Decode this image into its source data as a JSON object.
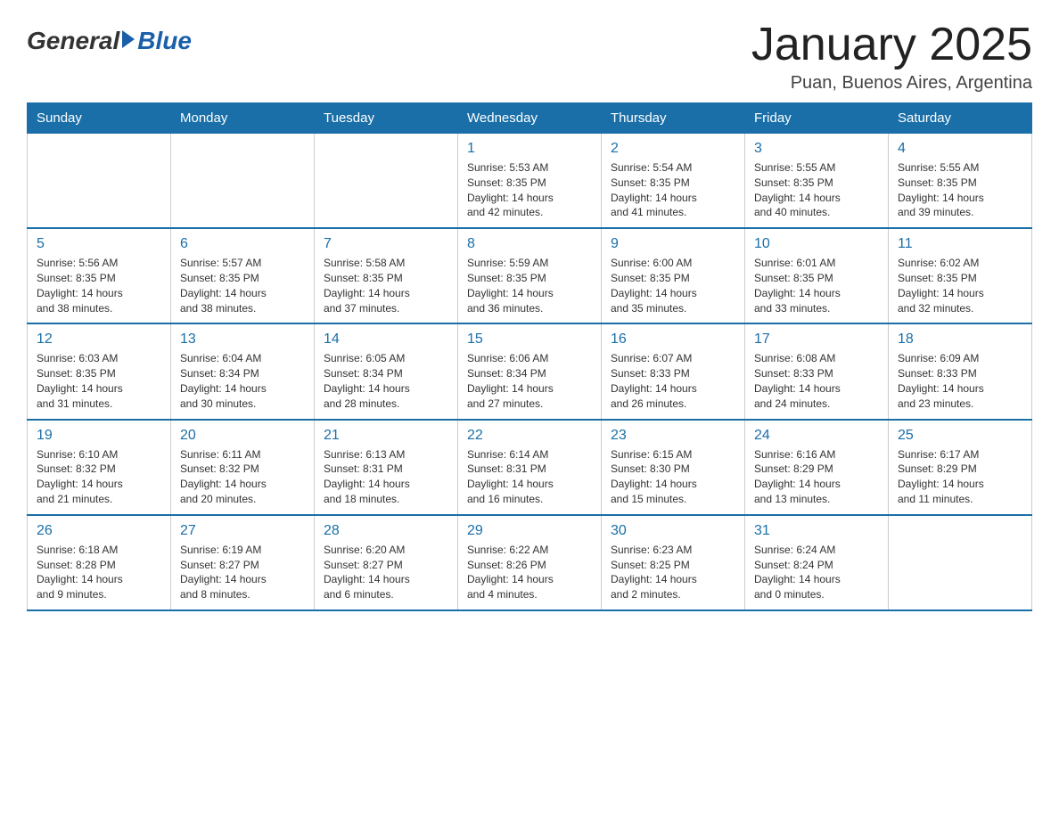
{
  "header": {
    "logo": {
      "general": "General",
      "blue": "Blue"
    },
    "title": "January 2025",
    "location": "Puan, Buenos Aires, Argentina"
  },
  "weekdays": [
    "Sunday",
    "Monday",
    "Tuesday",
    "Wednesday",
    "Thursday",
    "Friday",
    "Saturday"
  ],
  "weeks": [
    [
      {
        "day": "",
        "info": ""
      },
      {
        "day": "",
        "info": ""
      },
      {
        "day": "",
        "info": ""
      },
      {
        "day": "1",
        "info": "Sunrise: 5:53 AM\nSunset: 8:35 PM\nDaylight: 14 hours\nand 42 minutes."
      },
      {
        "day": "2",
        "info": "Sunrise: 5:54 AM\nSunset: 8:35 PM\nDaylight: 14 hours\nand 41 minutes."
      },
      {
        "day": "3",
        "info": "Sunrise: 5:55 AM\nSunset: 8:35 PM\nDaylight: 14 hours\nand 40 minutes."
      },
      {
        "day": "4",
        "info": "Sunrise: 5:55 AM\nSunset: 8:35 PM\nDaylight: 14 hours\nand 39 minutes."
      }
    ],
    [
      {
        "day": "5",
        "info": "Sunrise: 5:56 AM\nSunset: 8:35 PM\nDaylight: 14 hours\nand 38 minutes."
      },
      {
        "day": "6",
        "info": "Sunrise: 5:57 AM\nSunset: 8:35 PM\nDaylight: 14 hours\nand 38 minutes."
      },
      {
        "day": "7",
        "info": "Sunrise: 5:58 AM\nSunset: 8:35 PM\nDaylight: 14 hours\nand 37 minutes."
      },
      {
        "day": "8",
        "info": "Sunrise: 5:59 AM\nSunset: 8:35 PM\nDaylight: 14 hours\nand 36 minutes."
      },
      {
        "day": "9",
        "info": "Sunrise: 6:00 AM\nSunset: 8:35 PM\nDaylight: 14 hours\nand 35 minutes."
      },
      {
        "day": "10",
        "info": "Sunrise: 6:01 AM\nSunset: 8:35 PM\nDaylight: 14 hours\nand 33 minutes."
      },
      {
        "day": "11",
        "info": "Sunrise: 6:02 AM\nSunset: 8:35 PM\nDaylight: 14 hours\nand 32 minutes."
      }
    ],
    [
      {
        "day": "12",
        "info": "Sunrise: 6:03 AM\nSunset: 8:35 PM\nDaylight: 14 hours\nand 31 minutes."
      },
      {
        "day": "13",
        "info": "Sunrise: 6:04 AM\nSunset: 8:34 PM\nDaylight: 14 hours\nand 30 minutes."
      },
      {
        "day": "14",
        "info": "Sunrise: 6:05 AM\nSunset: 8:34 PM\nDaylight: 14 hours\nand 28 minutes."
      },
      {
        "day": "15",
        "info": "Sunrise: 6:06 AM\nSunset: 8:34 PM\nDaylight: 14 hours\nand 27 minutes."
      },
      {
        "day": "16",
        "info": "Sunrise: 6:07 AM\nSunset: 8:33 PM\nDaylight: 14 hours\nand 26 minutes."
      },
      {
        "day": "17",
        "info": "Sunrise: 6:08 AM\nSunset: 8:33 PM\nDaylight: 14 hours\nand 24 minutes."
      },
      {
        "day": "18",
        "info": "Sunrise: 6:09 AM\nSunset: 8:33 PM\nDaylight: 14 hours\nand 23 minutes."
      }
    ],
    [
      {
        "day": "19",
        "info": "Sunrise: 6:10 AM\nSunset: 8:32 PM\nDaylight: 14 hours\nand 21 minutes."
      },
      {
        "day": "20",
        "info": "Sunrise: 6:11 AM\nSunset: 8:32 PM\nDaylight: 14 hours\nand 20 minutes."
      },
      {
        "day": "21",
        "info": "Sunrise: 6:13 AM\nSunset: 8:31 PM\nDaylight: 14 hours\nand 18 minutes."
      },
      {
        "day": "22",
        "info": "Sunrise: 6:14 AM\nSunset: 8:31 PM\nDaylight: 14 hours\nand 16 minutes."
      },
      {
        "day": "23",
        "info": "Sunrise: 6:15 AM\nSunset: 8:30 PM\nDaylight: 14 hours\nand 15 minutes."
      },
      {
        "day": "24",
        "info": "Sunrise: 6:16 AM\nSunset: 8:29 PM\nDaylight: 14 hours\nand 13 minutes."
      },
      {
        "day": "25",
        "info": "Sunrise: 6:17 AM\nSunset: 8:29 PM\nDaylight: 14 hours\nand 11 minutes."
      }
    ],
    [
      {
        "day": "26",
        "info": "Sunrise: 6:18 AM\nSunset: 8:28 PM\nDaylight: 14 hours\nand 9 minutes."
      },
      {
        "day": "27",
        "info": "Sunrise: 6:19 AM\nSunset: 8:27 PM\nDaylight: 14 hours\nand 8 minutes."
      },
      {
        "day": "28",
        "info": "Sunrise: 6:20 AM\nSunset: 8:27 PM\nDaylight: 14 hours\nand 6 minutes."
      },
      {
        "day": "29",
        "info": "Sunrise: 6:22 AM\nSunset: 8:26 PM\nDaylight: 14 hours\nand 4 minutes."
      },
      {
        "day": "30",
        "info": "Sunrise: 6:23 AM\nSunset: 8:25 PM\nDaylight: 14 hours\nand 2 minutes."
      },
      {
        "day": "31",
        "info": "Sunrise: 6:24 AM\nSunset: 8:24 PM\nDaylight: 14 hours\nand 0 minutes."
      },
      {
        "day": "",
        "info": ""
      }
    ]
  ]
}
